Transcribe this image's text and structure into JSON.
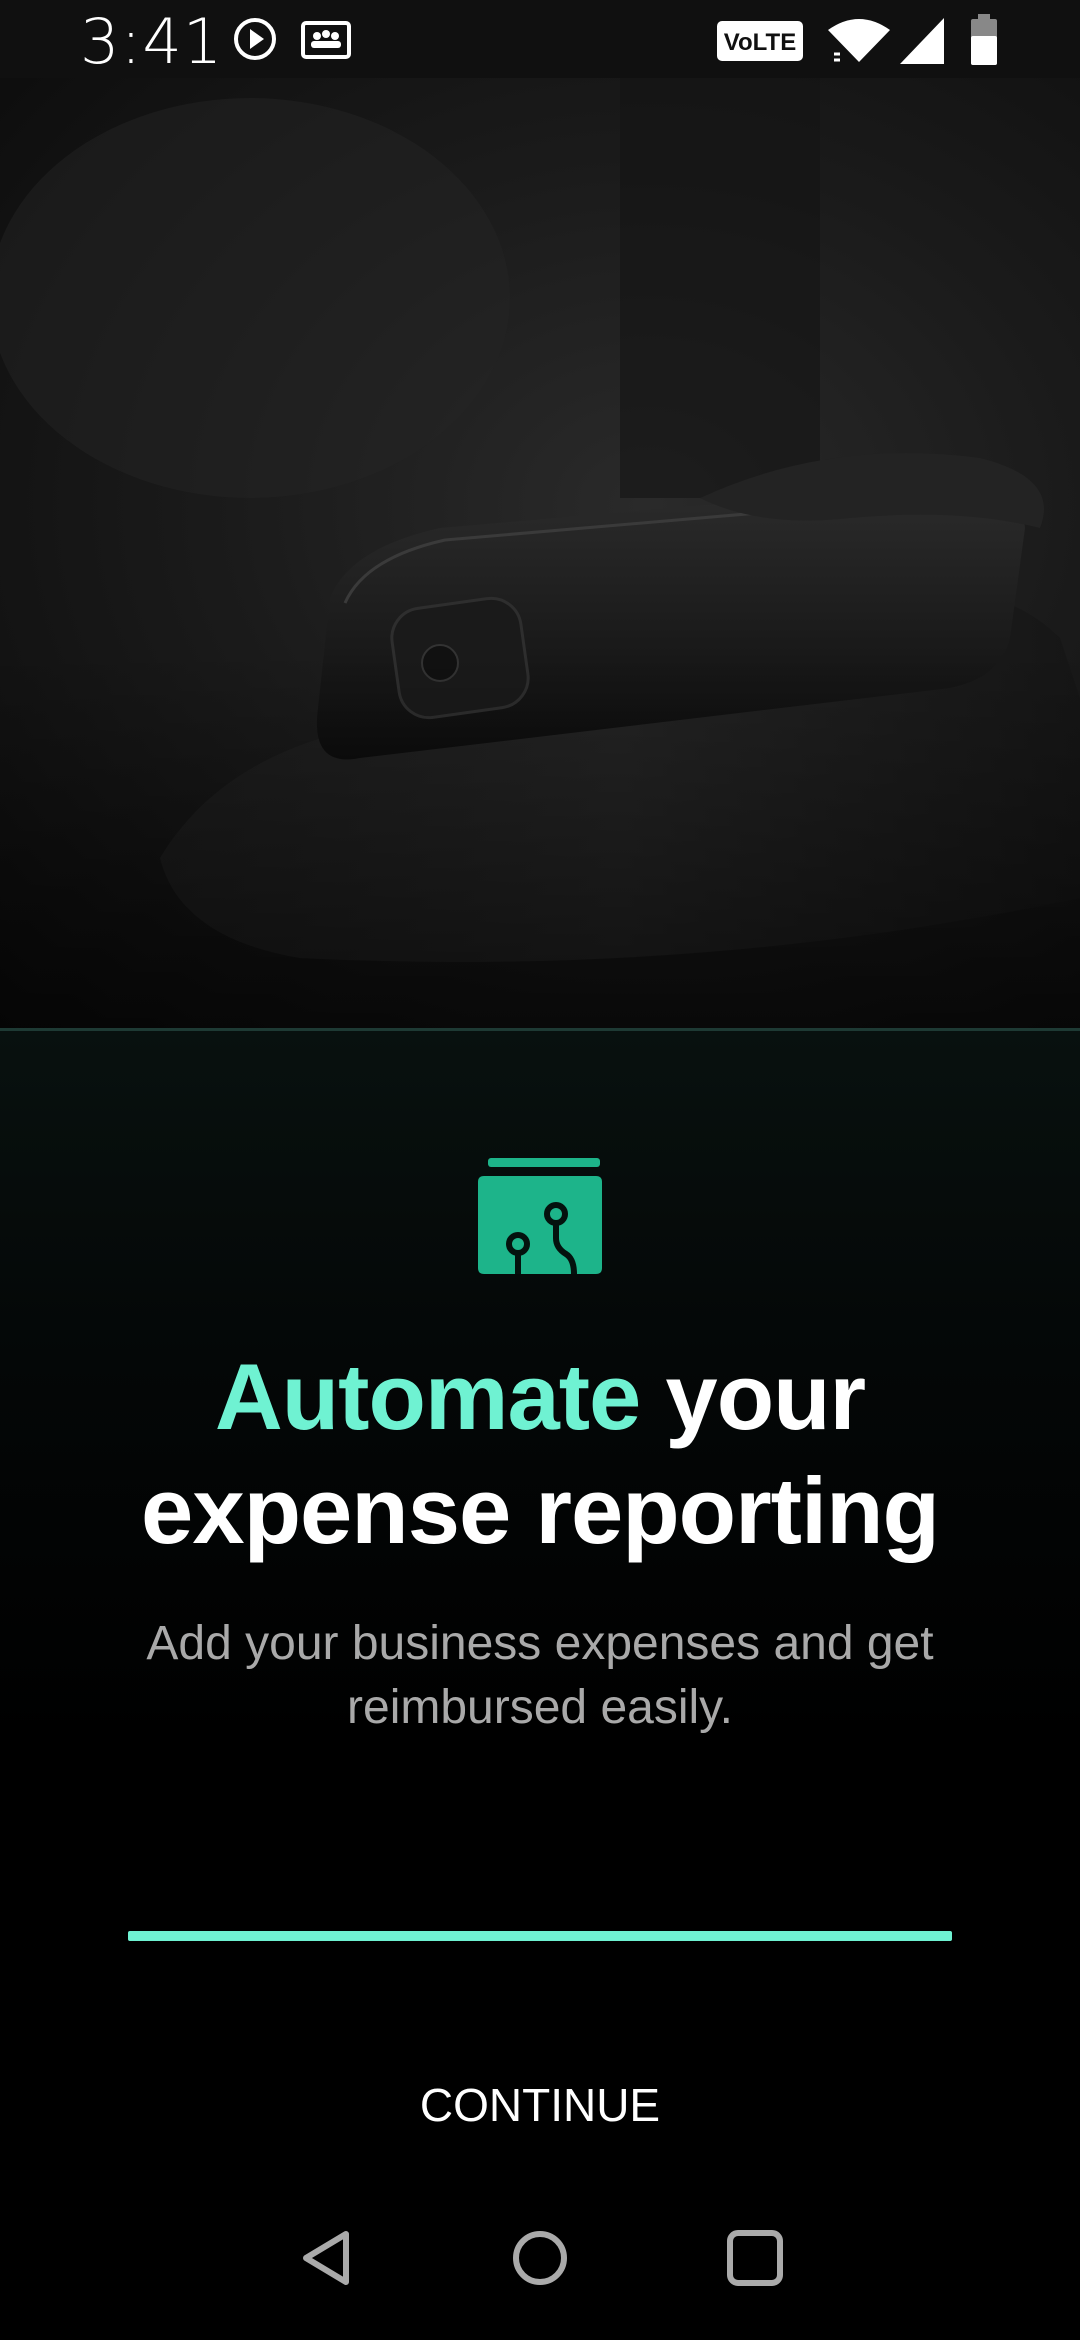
{
  "status_bar": {
    "time": "3:41",
    "icons": [
      "play-circle-icon",
      "gallery-icon",
      "volte-icon",
      "wifi-icon",
      "signal-icon",
      "battery-icon"
    ],
    "volte_label": "VoLTE"
  },
  "hero": {
    "image": "phone-in-hand-photo"
  },
  "onboarding": {
    "logo_icon": "wallet-circuit-icon",
    "headline_accent": "Automate",
    "headline_rest_line1": " your",
    "headline_line2": "expense reporting",
    "subtitle": "Add your business expenses and get reimbursed easily.",
    "progress": 1.0,
    "continue_label": "CONTINUE"
  },
  "navigation_bar": {
    "buttons": [
      "back-icon",
      "home-icon",
      "recents-icon"
    ]
  },
  "colors": {
    "accent": "#6ff2d2",
    "logo": "#1db48a",
    "background": "#000000",
    "subtitle": "#a9a9a9"
  }
}
